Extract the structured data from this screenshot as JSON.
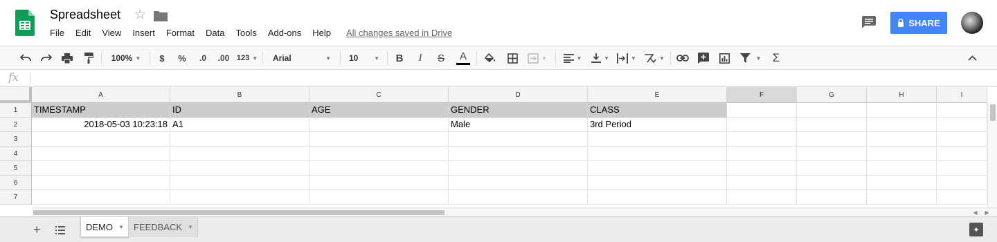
{
  "app": {
    "title": "Spreadsheet",
    "save_status": "All changes saved in Drive",
    "share_label": "SHARE"
  },
  "menu": [
    "File",
    "Edit",
    "View",
    "Insert",
    "Format",
    "Data",
    "Tools",
    "Add-ons",
    "Help"
  ],
  "toolbar": {
    "zoom": "100%",
    "currency": "$",
    "percent": "%",
    "decrease_decimals": ".0",
    "increase_decimals": ".00",
    "more_formats": "123",
    "font": "Arial",
    "font_size": "10",
    "bold": "B",
    "italic": "I",
    "strikethrough": "S",
    "text_color": "A",
    "functions": "Σ"
  },
  "formula_bar": {
    "fx": "fx",
    "value": ""
  },
  "grid": {
    "columns": [
      "A",
      "B",
      "C",
      "D",
      "E",
      "F",
      "G",
      "H",
      "I"
    ],
    "rows": [
      "1",
      "2",
      "3",
      "4",
      "5",
      "6",
      "7"
    ],
    "cells": [
      [
        "TIMESTAMP",
        "ID",
        "AGE",
        "GENDER",
        "CLASS"
      ],
      [
        "2018-05-03 10:23:18",
        "A1",
        "",
        "Male",
        "3rd Period"
      ]
    ]
  },
  "sheets": [
    {
      "name": "DEMO",
      "active": true
    },
    {
      "name": "FEEDBACK",
      "active": false
    }
  ],
  "colors": {
    "share_button": "#4285f4",
    "header_fill": "#cccccc",
    "logo_green": "#0f9d58"
  },
  "icons": {
    "logo": "sheets-logo-icon",
    "star": "star-icon",
    "folder": "folder-icon",
    "comments": "comment-icon",
    "lock": "lock-icon",
    "explore": "explore-icon"
  }
}
